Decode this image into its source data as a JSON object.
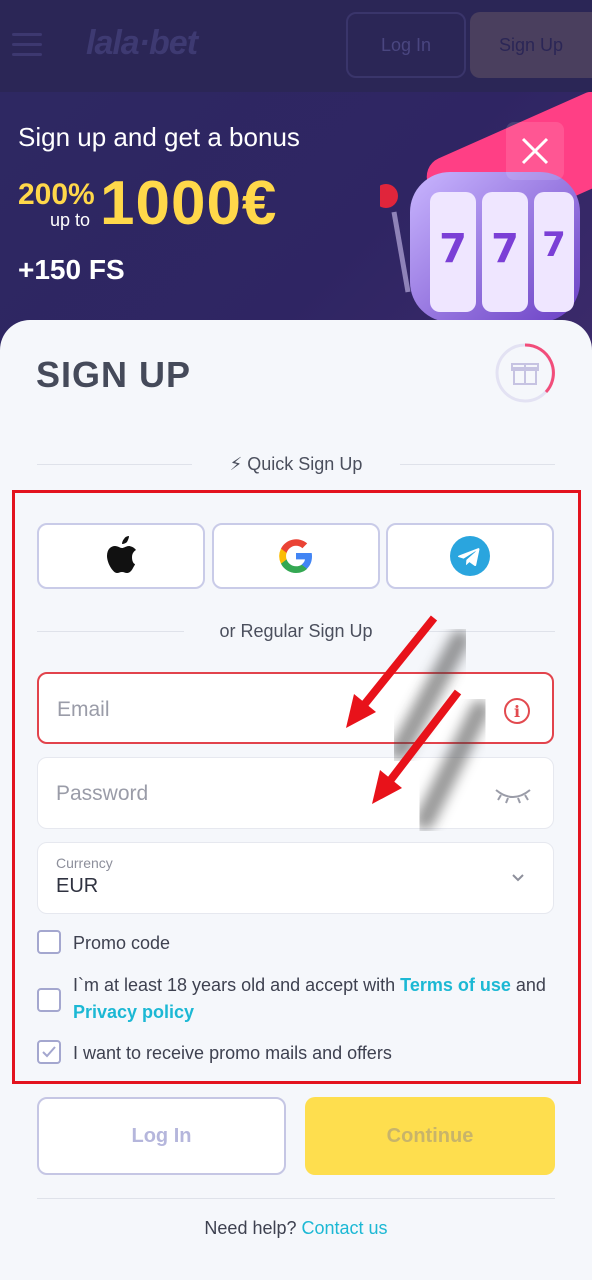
{
  "header": {
    "logo": "lala·bet",
    "login_label": "Log In",
    "signup_label": "Sign Up"
  },
  "banner": {
    "title": "Sign up and get a bonus",
    "percent": "200%",
    "up_to": "up to",
    "amount": "1000€",
    "free_spins": "+150 FS"
  },
  "form": {
    "title": "SIGN UP",
    "quick_signup": "⚡ Quick Sign Up",
    "regular_signup": "or Regular Sign Up",
    "email_placeholder": "Email",
    "password_placeholder": "Password",
    "currency_label": "Currency",
    "currency_value": "EUR",
    "promo_code": "Promo code",
    "terms_prefix": "I`m at least 18 years old and accept with ",
    "terms_link": "Terms of use",
    "terms_and": " and",
    "privacy_link": "Privacy policy",
    "promo_mails": "I want to receive promo mails and offers",
    "promo_mails_checked": true,
    "login_button": "Log In",
    "continue_button": "Continue",
    "help_text": "Need help?",
    "contact_link": "Contact us"
  },
  "colors": {
    "accent_yellow": "#fede4e",
    "link": "#1cb8d4",
    "error": "#e2434c",
    "highlight_box": "#e3131e"
  }
}
